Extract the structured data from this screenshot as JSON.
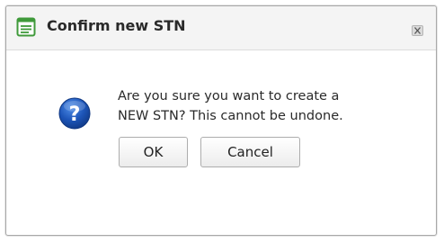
{
  "dialog": {
    "title": "Confirm new STN",
    "title_icon": "form-icon",
    "close_icon": "close-icon",
    "message_icon": "question-icon",
    "message_lines": [
      "Are you sure you want to create a",
      "NEW STN? This cannot be undone."
    ],
    "ok_label": "OK",
    "cancel_label": "Cancel"
  },
  "colors": {
    "icon_green": "#3f9a3a",
    "question_blue": "#1d55b8",
    "titlebar_bg": "#f4f4f4"
  }
}
